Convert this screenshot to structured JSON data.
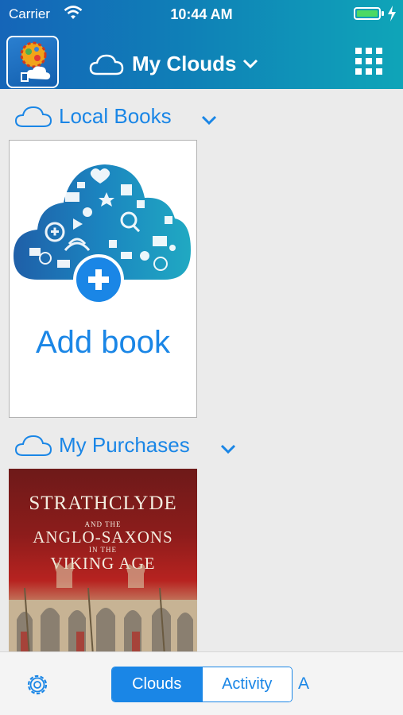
{
  "status_bar": {
    "carrier": "Carrier",
    "time": "10:44 AM",
    "battery_level": 1.0
  },
  "header": {
    "title": "My Clouds",
    "logo_icon": "app-logo-icon",
    "cloud_icon": "cloud-outline-icon",
    "menu_icon": "grid-menu-icon"
  },
  "sections": [
    {
      "label": "Local Books",
      "icon": "cloud-outline-icon"
    },
    {
      "label": "My Purchases",
      "icon": "cloud-outline-icon"
    }
  ],
  "local_books": {
    "add_book_label": "Add book",
    "illustration": "cloud-of-icons-with-plus"
  },
  "purchases": [
    {
      "title_line1": "STRATHCLYDE",
      "title_line2": "AND THE",
      "title_line3": "ANGLO-SAXONS",
      "title_line4": "IN THE",
      "title_line5": "VIKING AGE"
    }
  ],
  "tab_bar": {
    "settings_icon": "gear-icon",
    "segments": [
      "Clouds",
      "Activity"
    ],
    "selected": "Clouds",
    "extra": "A"
  },
  "colors": {
    "accent": "#1a86e6",
    "header_start": "#1565b8",
    "header_end": "#0fa5b8",
    "background": "#ebebeb"
  }
}
